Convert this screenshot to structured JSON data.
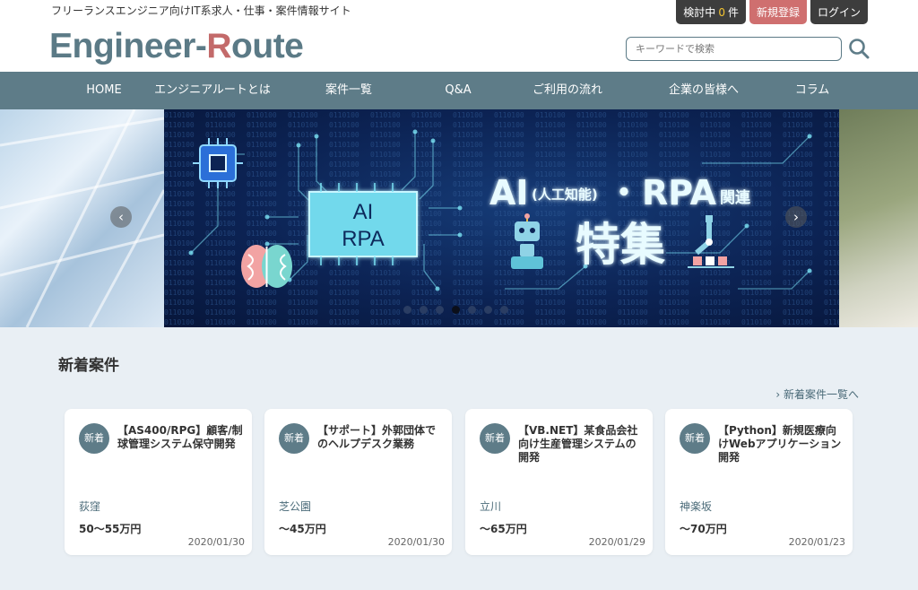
{
  "header": {
    "tagline": "フリーランスエンジニア向けIT系求人・仕事・案件情報サイト",
    "logo_part1": "Engineer-",
    "logo_hl": "R",
    "logo_part2": "oute",
    "btn_watch_prefix": "検討中",
    "btn_watch_count": "0",
    "btn_watch_suffix": "件",
    "btn_register": "新規登録",
    "btn_login": "ログイン",
    "search_placeholder": "キーワードで検索",
    "search_icon": "search-icon"
  },
  "nav": {
    "items": [
      "HOME",
      "エンジニアルートとは",
      "案件一覧",
      "Q&A",
      "ご利用の流れ",
      "企業の皆様へ",
      "コラム"
    ]
  },
  "hero": {
    "chip_line1": "AI",
    "chip_line2": "RPA",
    "headline_ai": "AI",
    "headline_paren": "(人工知能)",
    "headline_dot": "・",
    "headline_rpa": "RPA",
    "headline_kanren": "関連",
    "headline_main": "特集",
    "prev_icon": "chevron-left-icon",
    "next_icon": "chevron-right-icon",
    "dot_count": 7,
    "active_dot": 4
  },
  "listings": {
    "title": "新着案件",
    "more_link": "新着案件一覧へ",
    "cards": [
      {
        "badge": "新着",
        "title": "【AS400/RPG】顧客/制球管理システム保守開発",
        "location": "荻窪",
        "pay": "50〜55万円",
        "date": "2020/01/30"
      },
      {
        "badge": "新着",
        "title": "【サポート】外郭団体でのヘルプデスク業務",
        "location": "芝公園",
        "pay": "〜45万円",
        "date": "2020/01/30"
      },
      {
        "badge": "新着",
        "title": "【VB.NET】某食品会社向け生産管理システムの開発",
        "location": "立川",
        "pay": "〜65万円",
        "date": "2020/01/29"
      },
      {
        "badge": "新着",
        "title": "【Python】新規医療向けWebアプリケーション開発",
        "location": "神楽坂",
        "pay": "〜70万円",
        "date": "2020/01/23"
      }
    ]
  },
  "colors": {
    "brand": "#5e7c88",
    "accent_red": "#cf6f6f",
    "dark_button": "#3d3d3d",
    "count_yellow": "#f4c430",
    "section_bg": "#e9eff4",
    "banner_glow": "#7ce3f5"
  }
}
